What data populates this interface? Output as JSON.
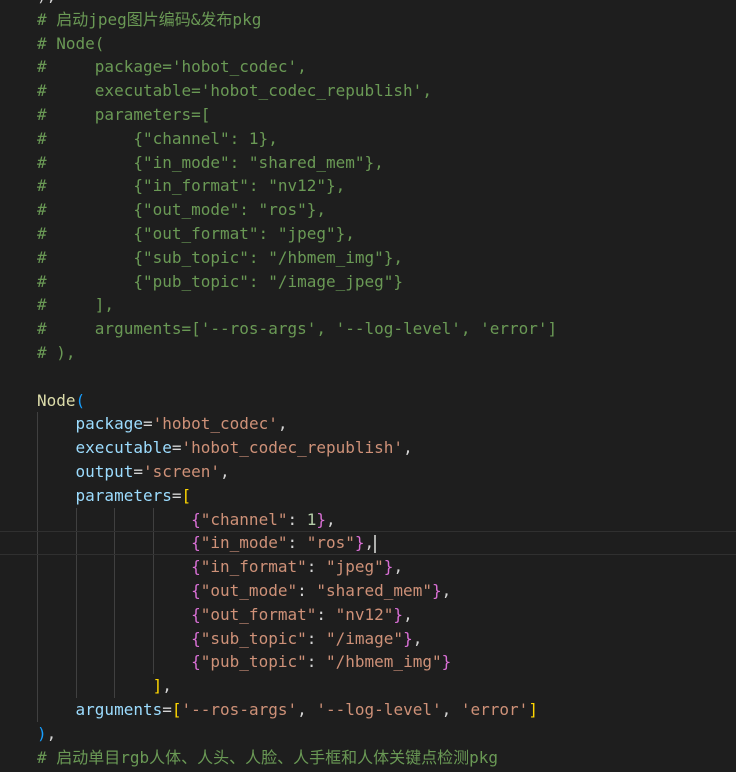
{
  "editor": {
    "lines": [
      {
        "indent": "",
        "tokens": [
          {
            "t": "),",
            "c": "op"
          }
        ]
      },
      {
        "indent": "",
        "tokens": [
          {
            "t": "# 启动jpeg图片编码&发布pkg",
            "c": "comment"
          }
        ]
      },
      {
        "indent": "",
        "tokens": [
          {
            "t": "# Node(",
            "c": "comment"
          }
        ]
      },
      {
        "indent": "",
        "tokens": [
          {
            "t": "#     package='hobot_codec',",
            "c": "comment"
          }
        ]
      },
      {
        "indent": "",
        "tokens": [
          {
            "t": "#     executable='hobot_codec_republish',",
            "c": "comment"
          }
        ]
      },
      {
        "indent": "",
        "tokens": [
          {
            "t": "#     parameters=[",
            "c": "comment"
          }
        ]
      },
      {
        "indent": "",
        "tokens": [
          {
            "t": "#         {\"channel\": 1},",
            "c": "comment"
          }
        ]
      },
      {
        "indent": "",
        "tokens": [
          {
            "t": "#         {\"in_mode\": \"shared_mem\"},",
            "c": "comment"
          }
        ]
      },
      {
        "indent": "",
        "tokens": [
          {
            "t": "#         {\"in_format\": \"nv12\"},",
            "c": "comment"
          }
        ]
      },
      {
        "indent": "",
        "tokens": [
          {
            "t": "#         {\"out_mode\": \"ros\"},",
            "c": "comment"
          }
        ]
      },
      {
        "indent": "",
        "tokens": [
          {
            "t": "#         {\"out_format\": \"jpeg\"},",
            "c": "comment"
          }
        ]
      },
      {
        "indent": "",
        "tokens": [
          {
            "t": "#         {\"sub_topic\": \"/hbmem_img\"},",
            "c": "comment"
          }
        ]
      },
      {
        "indent": "",
        "tokens": [
          {
            "t": "#         {\"pub_topic\": \"/image_jpeg\"}",
            "c": "comment"
          }
        ]
      },
      {
        "indent": "",
        "tokens": [
          {
            "t": "#     ],",
            "c": "comment"
          }
        ]
      },
      {
        "indent": "",
        "tokens": [
          {
            "t": "#     arguments=['--ros-args', '--log-level', 'error']",
            "c": "comment"
          }
        ]
      },
      {
        "indent": "",
        "tokens": [
          {
            "t": "# ),",
            "c": "comment"
          }
        ]
      },
      {
        "indent": "",
        "tokens": []
      },
      {
        "indent": "",
        "tokens": [
          {
            "t": "Node",
            "c": "func"
          },
          {
            "t": "(",
            "c": "b3"
          }
        ]
      },
      {
        "indent": "    ",
        "tokens": [
          {
            "t": "package",
            "c": "param"
          },
          {
            "t": "=",
            "c": "op"
          },
          {
            "t": "'hobot_codec'",
            "c": "str"
          },
          {
            "t": ",",
            "c": "op"
          }
        ]
      },
      {
        "indent": "    ",
        "tokens": [
          {
            "t": "executable",
            "c": "param"
          },
          {
            "t": "=",
            "c": "op"
          },
          {
            "t": "'hobot_codec_republish'",
            "c": "str"
          },
          {
            "t": ",",
            "c": "op"
          }
        ]
      },
      {
        "indent": "    ",
        "tokens": [
          {
            "t": "output",
            "c": "param"
          },
          {
            "t": "=",
            "c": "op"
          },
          {
            "t": "'screen'",
            "c": "str"
          },
          {
            "t": ",",
            "c": "op"
          }
        ]
      },
      {
        "indent": "    ",
        "tokens": [
          {
            "t": "parameters",
            "c": "param"
          },
          {
            "t": "=",
            "c": "op"
          },
          {
            "t": "[",
            "c": "b1"
          }
        ]
      },
      {
        "indent": "                ",
        "tokens": [
          {
            "t": "{",
            "c": "b2"
          },
          {
            "t": "\"channel\"",
            "c": "str"
          },
          {
            "t": ": ",
            "c": "op"
          },
          {
            "t": "1",
            "c": "num"
          },
          {
            "t": "}",
            "c": "b2"
          },
          {
            "t": ",",
            "c": "op"
          }
        ]
      },
      {
        "indent": "                ",
        "current": true,
        "tokens": [
          {
            "t": "{",
            "c": "b2"
          },
          {
            "t": "\"in_mode\"",
            "c": "str"
          },
          {
            "t": ": ",
            "c": "op"
          },
          {
            "t": "\"ros\"",
            "c": "str"
          },
          {
            "t": "}",
            "c": "b2"
          },
          {
            "t": ",",
            "c": "op"
          }
        ]
      },
      {
        "indent": "                ",
        "tokens": [
          {
            "t": "{",
            "c": "b2"
          },
          {
            "t": "\"in_format\"",
            "c": "str"
          },
          {
            "t": ": ",
            "c": "op"
          },
          {
            "t": "\"jpeg\"",
            "c": "str"
          },
          {
            "t": "}",
            "c": "b2"
          },
          {
            "t": ",",
            "c": "op"
          }
        ]
      },
      {
        "indent": "                ",
        "tokens": [
          {
            "t": "{",
            "c": "b2"
          },
          {
            "t": "\"out_mode\"",
            "c": "str"
          },
          {
            "t": ": ",
            "c": "op"
          },
          {
            "t": "\"shared_mem\"",
            "c": "str"
          },
          {
            "t": "}",
            "c": "b2"
          },
          {
            "t": ",",
            "c": "op"
          }
        ]
      },
      {
        "indent": "                ",
        "tokens": [
          {
            "t": "{",
            "c": "b2"
          },
          {
            "t": "\"out_format\"",
            "c": "str"
          },
          {
            "t": ": ",
            "c": "op"
          },
          {
            "t": "\"nv12\"",
            "c": "str"
          },
          {
            "t": "}",
            "c": "b2"
          },
          {
            "t": ",",
            "c": "op"
          }
        ]
      },
      {
        "indent": "                ",
        "tokens": [
          {
            "t": "{",
            "c": "b2"
          },
          {
            "t": "\"sub_topic\"",
            "c": "str"
          },
          {
            "t": ": ",
            "c": "op"
          },
          {
            "t": "\"/image\"",
            "c": "str"
          },
          {
            "t": "}",
            "c": "b2"
          },
          {
            "t": ",",
            "c": "op"
          }
        ]
      },
      {
        "indent": "                ",
        "tokens": [
          {
            "t": "{",
            "c": "b2"
          },
          {
            "t": "\"pub_topic\"",
            "c": "str"
          },
          {
            "t": ": ",
            "c": "op"
          },
          {
            "t": "\"/hbmem_img\"",
            "c": "str"
          },
          {
            "t": "}",
            "c": "b2"
          }
        ]
      },
      {
        "indent": "            ",
        "tokens": [
          {
            "t": "]",
            "c": "b1"
          },
          {
            "t": ",",
            "c": "op"
          }
        ]
      },
      {
        "indent": "    ",
        "tokens": [
          {
            "t": "arguments",
            "c": "param"
          },
          {
            "t": "=",
            "c": "op"
          },
          {
            "t": "[",
            "c": "b1"
          },
          {
            "t": "'--ros-args'",
            "c": "str"
          },
          {
            "t": ", ",
            "c": "op"
          },
          {
            "t": "'--log-level'",
            "c": "str"
          },
          {
            "t": ", ",
            "c": "op"
          },
          {
            "t": "'error'",
            "c": "str"
          },
          {
            "t": "]",
            "c": "b1"
          }
        ]
      },
      {
        "indent": "",
        "tokens": [
          {
            "t": ")",
            "c": "b3"
          },
          {
            "t": ",",
            "c": "op"
          }
        ]
      },
      {
        "indent": "",
        "tokens": [
          {
            "t": "# 启动单目rgb人体、人头、人脸、人手框和人体关键点检测pkg",
            "c": "comment"
          }
        ]
      }
    ],
    "colors": {
      "background": "#1e1e1e",
      "comment": "#6a9955",
      "function": "#dcdcaa",
      "parameter": "#9cdcfe",
      "string": "#ce9178",
      "number": "#b5cea8",
      "bracket_level1": "#ffd700",
      "bracket_level2": "#da70d6",
      "bracket_level3": "#179fff"
    }
  }
}
